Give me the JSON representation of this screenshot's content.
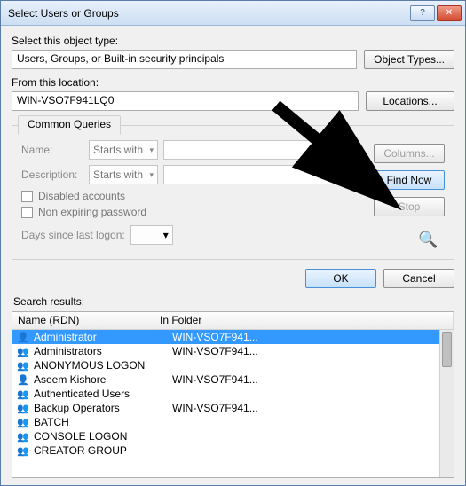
{
  "title": "Select Users or Groups",
  "labels": {
    "object_type": "Select this object type:",
    "from_location": "From this location:",
    "search_results": "Search results:"
  },
  "object_type_value": "Users, Groups, or Built-in security principals",
  "location_value": "WIN-VSO7F941LQ0",
  "buttons": {
    "object_types": "Object Types...",
    "locations": "Locations...",
    "columns": "Columns...",
    "find_now": "Find Now",
    "stop": "Stop",
    "ok": "OK",
    "cancel": "Cancel"
  },
  "common_queries": {
    "tab": "Common Queries",
    "name_label": "Name:",
    "desc_label": "Description:",
    "starts_with": "Starts with",
    "disabled_accounts": "Disabled accounts",
    "non_expiring": "Non expiring password",
    "days_label": "Days since last logon:"
  },
  "grid": {
    "col_name": "Name (RDN)",
    "col_folder": "In Folder",
    "rows": [
      {
        "icon": "user",
        "name": "Administrator",
        "folder": "WIN-VSO7F941...",
        "selected": true
      },
      {
        "icon": "group",
        "name": "Administrators",
        "folder": "WIN-VSO7F941..."
      },
      {
        "icon": "group",
        "name": "ANONYMOUS LOGON",
        "folder": ""
      },
      {
        "icon": "user",
        "name": "Aseem Kishore",
        "folder": "WIN-VSO7F941..."
      },
      {
        "icon": "group",
        "name": "Authenticated Users",
        "folder": ""
      },
      {
        "icon": "group",
        "name": "Backup Operators",
        "folder": "WIN-VSO7F941..."
      },
      {
        "icon": "group",
        "name": "BATCH",
        "folder": ""
      },
      {
        "icon": "group",
        "name": "CONSOLE LOGON",
        "folder": ""
      },
      {
        "icon": "group",
        "name": "CREATOR GROUP",
        "folder": ""
      }
    ]
  }
}
